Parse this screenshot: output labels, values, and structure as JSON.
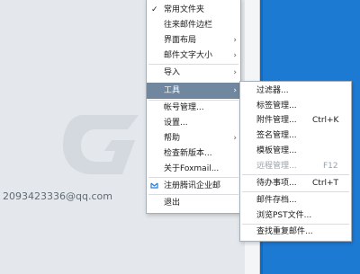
{
  "account": {
    "email": "2093423336@qq.com"
  },
  "main_menu": {
    "items": [
      {
        "label": "常用文件夹",
        "checked": true
      },
      {
        "label": "往来邮件边栏"
      },
      {
        "label": "界面布局",
        "submenu": true
      },
      {
        "label": "邮件文字大小",
        "submenu": true
      },
      {
        "label": "导入",
        "submenu": true
      },
      {
        "label": "工具",
        "submenu": true,
        "highlighted": true
      },
      {
        "label": "帐号管理..."
      },
      {
        "label": "设置..."
      },
      {
        "label": "帮助",
        "submenu": true
      },
      {
        "label": "检查新版本..."
      },
      {
        "label": "关于Foxmail..."
      },
      {
        "label": "注册腾讯企业邮",
        "icon": "qq-exmail-icon"
      },
      {
        "label": "退出"
      }
    ]
  },
  "tools_submenu": {
    "items": [
      {
        "label": "过滤器..."
      },
      {
        "label": "标签管理..."
      },
      {
        "label": "附件管理...",
        "shortcut": "Ctrl+K"
      },
      {
        "label": "签名管理..."
      },
      {
        "label": "模板管理..."
      },
      {
        "label": "远程管理...",
        "shortcut": "F12",
        "disabled": true
      },
      {
        "label": "待办事项...",
        "shortcut": "Ctrl+T"
      },
      {
        "label": "邮件存档..."
      },
      {
        "label": "浏览PST文件..."
      },
      {
        "label": "查找重复邮件..."
      }
    ]
  },
  "colors": {
    "highlight": "#7187a0",
    "desktop": "#0e6bc6"
  }
}
